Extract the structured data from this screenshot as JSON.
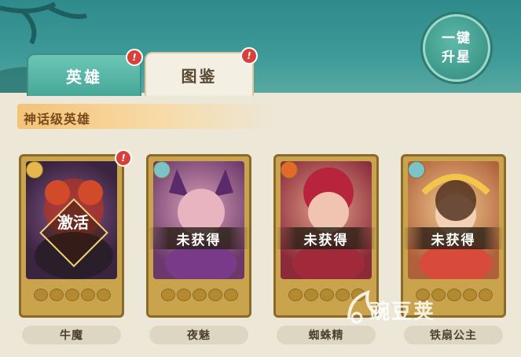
{
  "tabs": [
    {
      "label": "英雄"
    },
    {
      "label": "图鉴"
    }
  ],
  "upgrade_button": {
    "line1": "一键",
    "line2": "升星"
  },
  "banner": {
    "title": "神话级英雄"
  },
  "heroes": [
    {
      "name": "牛魔",
      "status": "激活"
    },
    {
      "name": "夜魅",
      "status": "未获得"
    },
    {
      "name": "蜘蛛精",
      "status": "未获得"
    },
    {
      "name": "铁扇公主",
      "status": "未获得"
    }
  ],
  "watermark": {
    "text": "豌豆荚"
  },
  "colors": {
    "accent": "#47a898",
    "badge": "#d8413a",
    "card": "#c9a44c"
  }
}
